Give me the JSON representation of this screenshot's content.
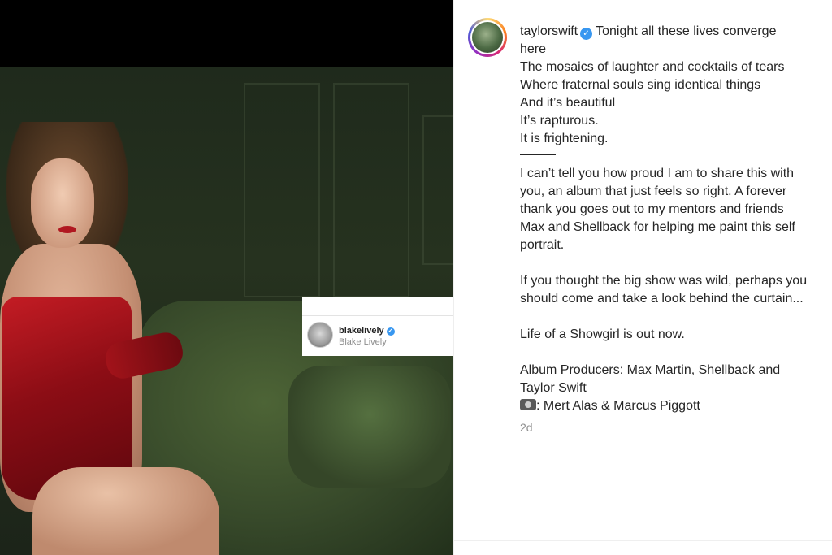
{
  "post": {
    "username": "taylorswift",
    "verified_icon": "verified-badge-icon",
    "caption_first": "Tonight all these lives converge",
    "caption_lines": [
      "here",
      "The mosaics of laughter and cocktails of tears",
      "Where fraternal souls sing identical things",
      "And it’s beautiful",
      "It’s rapturous.",
      "It is frightening."
    ],
    "paragraph1": [
      "I can’t tell you how proud I am to share this with",
      "you, an album that just feels so right. A forever",
      "thank you goes out to my mentors and friends",
      "Max and Shellback for helping me paint this self",
      "portrait."
    ],
    "paragraph2": [
      "If you thought the big show was wild, perhaps you",
      "should come and take a look behind the curtain..."
    ],
    "paragraph3": "Life of a Showgirl is out now.",
    "paragraph4": [
      "Album Producers: Max Martin, Shellback and",
      "Taylor Swift"
    ],
    "photo_credit": ": Mert Alas & Marcus Piggott",
    "photo_credit_icon": "camera-icon",
    "timestamp": "2d"
  },
  "likes_popup": {
    "title": "Likes",
    "user": "blakelively",
    "name": "Blake Lively"
  }
}
